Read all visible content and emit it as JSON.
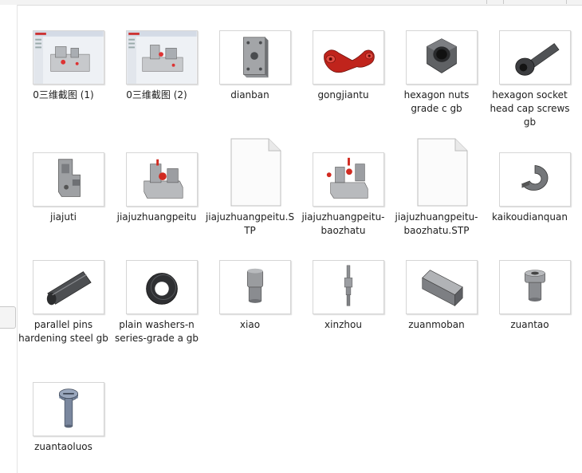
{
  "files": [
    {
      "name": "0三维截图 (1)",
      "icon": "solidworks-screenshot-icon"
    },
    {
      "name": "0三维截图 (2)",
      "icon": "solidworks-screenshot-icon"
    },
    {
      "name": "dianban",
      "icon": "plate-part-icon"
    },
    {
      "name": "gongjiantu",
      "icon": "workpiece-part-icon"
    },
    {
      "name": "hexagon nuts grade c gb",
      "icon": "hex-nut-icon"
    },
    {
      "name": "hexagon socket head cap screws gb",
      "icon": "socket-cap-screw-icon"
    },
    {
      "name": "jiajuti",
      "icon": "fixture-body-icon"
    },
    {
      "name": "jiajuzhuangpeitu",
      "icon": "fixture-assembly-icon"
    },
    {
      "name": "jiajuzhuangpeitu.STP",
      "icon": "blank-document-icon"
    },
    {
      "name": "jiajuzhuangpeitu-baozhatu",
      "icon": "exploded-assembly-icon"
    },
    {
      "name": "jiajuzhuangpeitu-baozhatu.STP",
      "icon": "blank-document-icon"
    },
    {
      "name": "kaikoudianquan",
      "icon": "open-washer-icon"
    },
    {
      "name": "parallel pins hardening steel gb",
      "icon": "parallel-pin-icon"
    },
    {
      "name": "plain washers-n series-grade a gb",
      "icon": "plain-washer-icon"
    },
    {
      "name": "xiao",
      "icon": "pin-part-icon"
    },
    {
      "name": "xinzhou",
      "icon": "mandrel-part-icon"
    },
    {
      "name": "zuanmoban",
      "icon": "drill-plate-icon"
    },
    {
      "name": "zuantao",
      "icon": "drill-bushing-icon"
    },
    {
      "name": "zuantaoluos",
      "icon": "bushing-screw-icon"
    }
  ]
}
